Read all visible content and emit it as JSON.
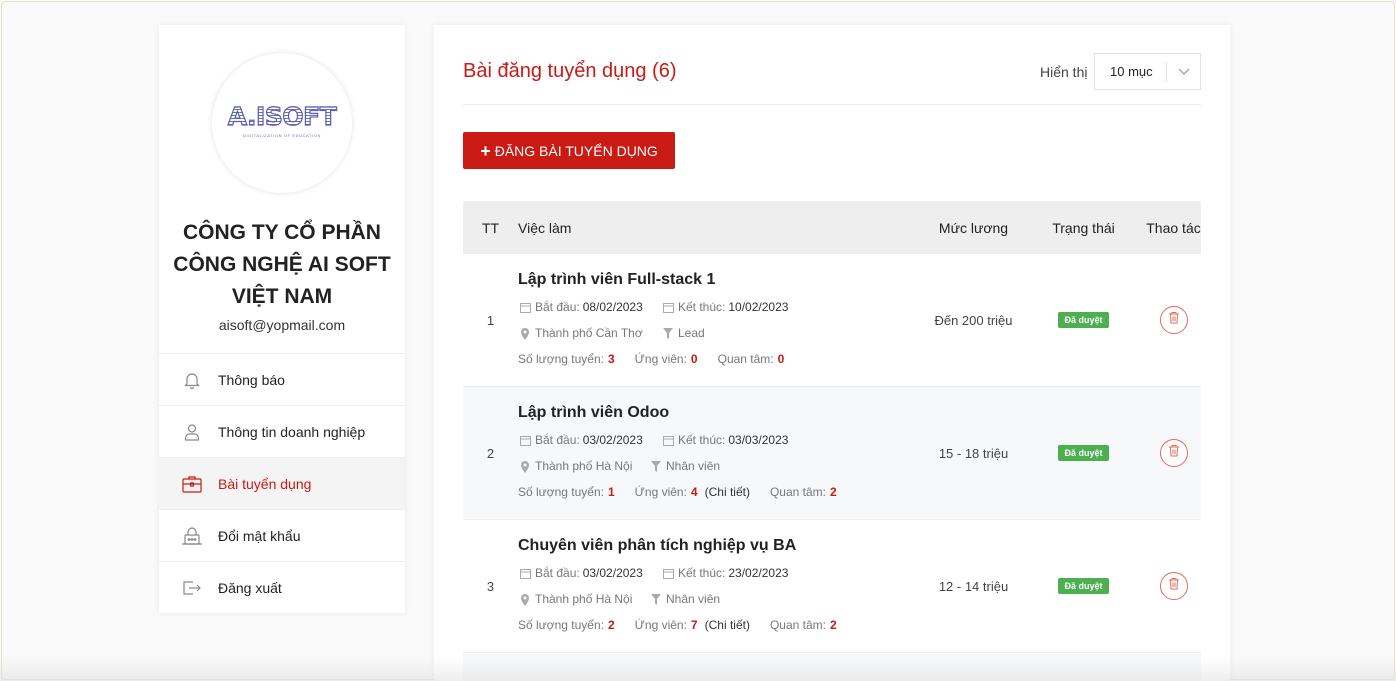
{
  "company": {
    "logo_text": "A.ISOFT",
    "logo_subtitle": "DIGITALIZATION OF EDUCATION",
    "name_line1": "CÔNG TY CỔ PHẦN",
    "name_line2": "CÔNG NGHỆ AI SOFT",
    "name_line3": "VIỆT NAM",
    "email": "aisoft@yopmail.com"
  },
  "menu": [
    {
      "label": "Thông báo",
      "icon": "bell-icon"
    },
    {
      "label": "Thông tin doanh nghiệp",
      "icon": "user-icon"
    },
    {
      "label": "Bài tuyển dụng",
      "icon": "briefcase-icon",
      "active": true
    },
    {
      "label": "Đổi mật khẩu",
      "icon": "lock-icon"
    },
    {
      "label": "Đăng xuất",
      "icon": "logout-icon"
    }
  ],
  "main": {
    "title": "Bài đăng tuyển dụng (6)",
    "show_label": "Hiển thị",
    "show_value": "10 mục",
    "add_button": "ĐĂNG BÀI TUYỂN DỤNG"
  },
  "table": {
    "headers": {
      "tt": "TT",
      "job": "Việc làm",
      "salary": "Mức lương",
      "status": "Trạng thái",
      "action": "Thao tác"
    },
    "labels": {
      "start": "Bắt đầu:",
      "end": "Kết thúc:",
      "quantity": "Số lượng tuyển:",
      "applicants": "Ứng viên:",
      "interested": "Quan tâm:",
      "details": "(Chi tiết)"
    },
    "rows": [
      {
        "tt": "1",
        "title": "Lập trình viên Full-stack 1",
        "start": "08/02/2023",
        "end": "10/02/2023",
        "location": "Thành phố Cần Thơ",
        "level": "Lead",
        "quantity": "3",
        "applicants": "0",
        "interested": "0",
        "salary": "Đến 200 triệu",
        "status": "Đã duyệt"
      },
      {
        "tt": "2",
        "title": "Lập trình viên Odoo",
        "start": "03/02/2023",
        "end": "03/03/2023",
        "location": "Thành phố Hà Nội",
        "level": "Nhân viên",
        "quantity": "1",
        "applicants": "4",
        "interested": "2",
        "salary": "15 - 18 triệu",
        "status": "Đã duyệt"
      },
      {
        "tt": "3",
        "title": "Chuyên viên phân tích nghiệp vụ BA",
        "start": "03/02/2023",
        "end": "23/02/2023",
        "location": "Thành phố Hà Nội",
        "level": "Nhân viên",
        "quantity": "2",
        "applicants": "7",
        "interested": "2",
        "salary": "12 - 14 triệu",
        "status": "Đã duyệt"
      }
    ]
  },
  "colors": {
    "accent": "#c91a14",
    "approved": "#4caf50"
  }
}
